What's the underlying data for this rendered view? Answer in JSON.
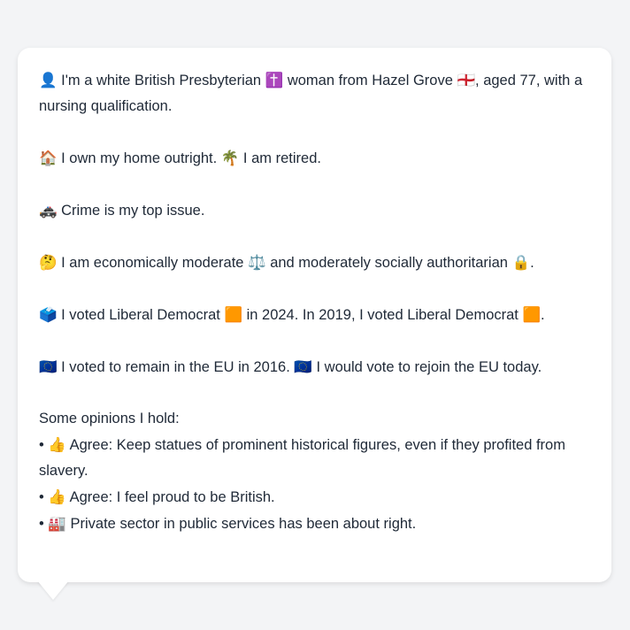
{
  "message": {
    "identity": {
      "icon1": "👤",
      "t1": " I'm a white British Presbyterian ",
      "icon2": "✝️",
      "t2": " woman from Hazel Grove ",
      "icon3": "🏴󠁧󠁢󠁥󠁮󠁧󠁿",
      "t3": ", aged 77, with a nursing qualification."
    },
    "home": {
      "icon1": "🏠",
      "t1": " I own my home outright. ",
      "icon2": "🌴",
      "t2": " I am retired."
    },
    "issue": {
      "icon1": "🚓",
      "t1": " Crime is my top issue."
    },
    "ideology": {
      "icon1": "🤔",
      "t1": " I am economically moderate ",
      "icon2": "⚖️",
      "t2": " and moderately socially authoritarian ",
      "icon3": "🔒",
      "t3": "."
    },
    "vote": {
      "icon1": "🗳️",
      "t1": " I voted Liberal Democrat ",
      "icon2": "🟧",
      "t2": " in 2024. In 2019, I voted Liberal Democrat ",
      "icon3": "🟧",
      "t3": "."
    },
    "eu": {
      "icon1": "🇪🇺",
      "t1": " I voted to remain in the EU in 2016. ",
      "icon2": "🇪🇺",
      "t2": " I would vote to rejoin the EU today."
    },
    "opinions": {
      "heading": "Some opinions I hold:",
      "items": [
        {
          "bullet": "•",
          "icon": "👍",
          "text": " Agree: Keep statues of prominent historical figures, even if they profited from slavery."
        },
        {
          "bullet": "•",
          "icon": "👍",
          "text": " Agree: I feel proud to be British."
        },
        {
          "bullet": "•",
          "icon": "🏭",
          "text": " Private sector in public services has been about right."
        }
      ]
    }
  }
}
